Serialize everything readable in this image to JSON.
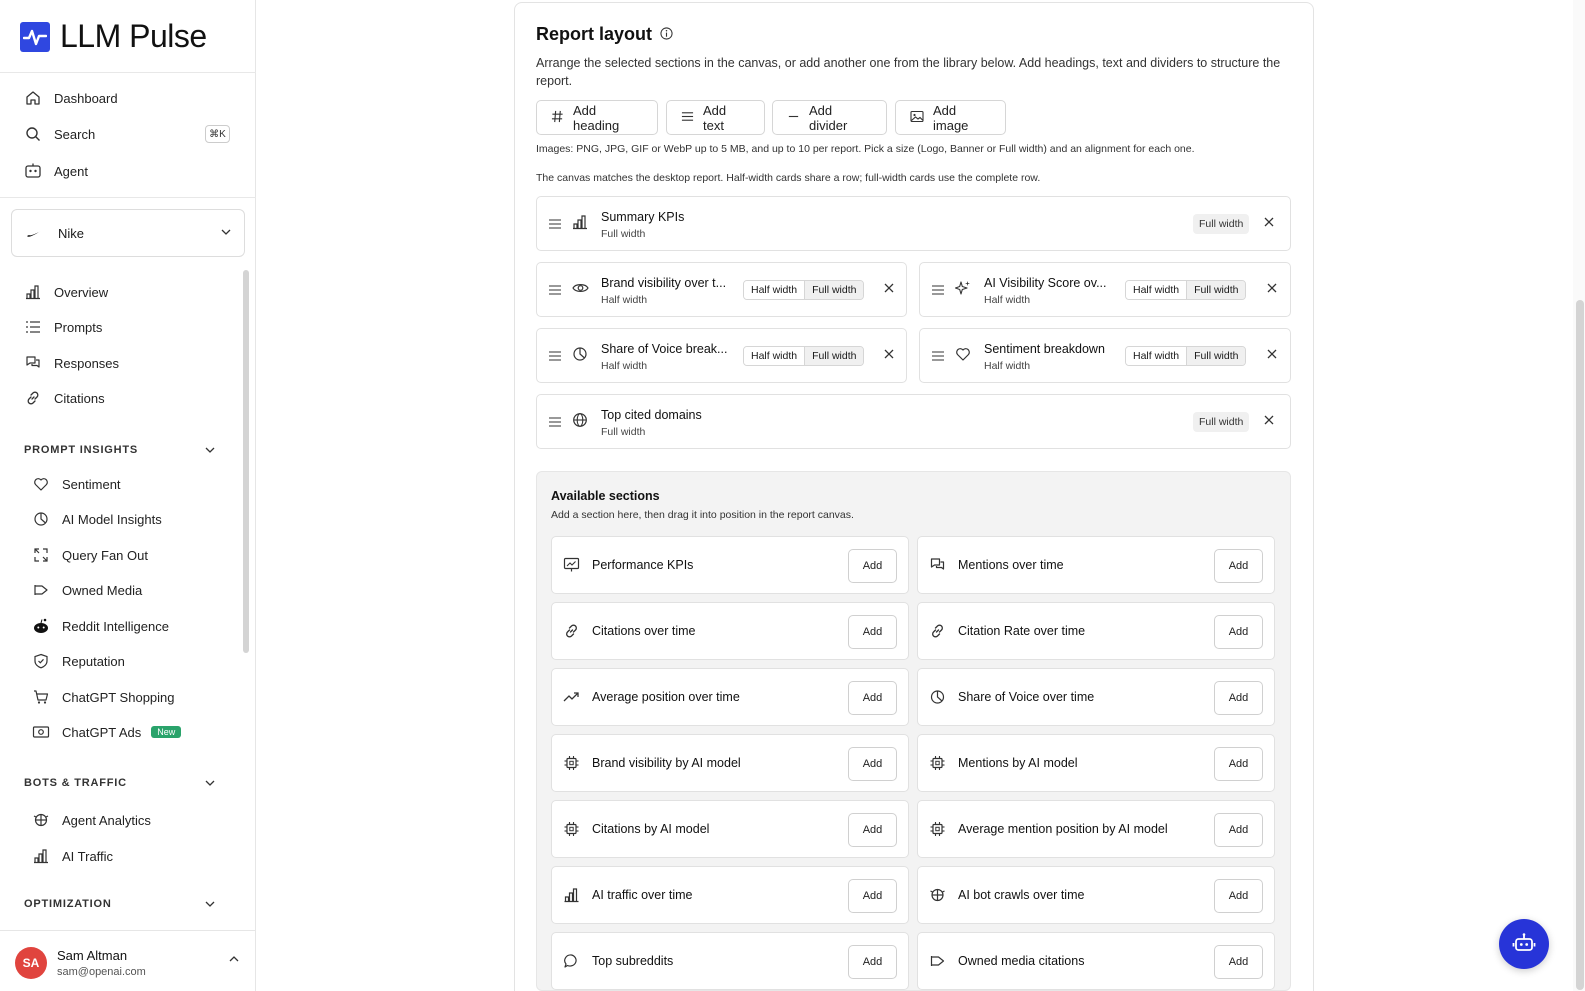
{
  "app": {
    "name": "LLM Pulse"
  },
  "nav": {
    "dashboard": "Dashboard",
    "search": "Search",
    "search_shortcut": "⌘K",
    "agent": "Agent"
  },
  "brand": {
    "name": "Nike"
  },
  "main_nav": [
    "Overview",
    "Prompts",
    "Responses",
    "Citations"
  ],
  "prompt_insights": {
    "heading": "PROMPT INSIGHTS",
    "items": [
      "Sentiment",
      "AI Model Insights",
      "Query Fan Out",
      "Owned Media",
      "Reddit Intelligence",
      "Reputation",
      "ChatGPT Shopping",
      "ChatGPT Ads"
    ],
    "new_badge": "New"
  },
  "bots_traffic": {
    "heading": "BOTS & TRAFFIC",
    "items": [
      "Agent Analytics",
      "AI Traffic"
    ]
  },
  "optimization": {
    "heading": "OPTIMIZATION"
  },
  "user": {
    "initials": "SA",
    "name": "Sam Altman",
    "email": "sam@openai.com"
  },
  "report": {
    "title": "Report layout",
    "description": "Arrange the selected sections in the canvas, or add another one from the library below. Add headings, text and dividers to structure the report.",
    "buttons": {
      "heading": "Add heading",
      "text": "Add text",
      "divider": "Add divider",
      "image": "Add image"
    },
    "images_note": "Images: PNG, JPG, GIF or WebP up to 5 MB, and up to 10 per report. Pick a size (Logo, Banner or Full width) and an alignment for each one.",
    "canvas_note": "The canvas matches the desktop report. Half-width cards share a row; full-width cards use the complete row.",
    "half_label": "Half width",
    "full_label": "Full width",
    "cards": [
      {
        "title": "Summary KPIs",
        "width": "Full width"
      },
      {
        "title": "Brand visibility over t...",
        "width": "Half width"
      },
      {
        "title": "AI Visibility Score ov...",
        "width": "Half width"
      },
      {
        "title": "Share of Voice break...",
        "width": "Half width"
      },
      {
        "title": "Sentiment breakdown",
        "width": "Half width"
      },
      {
        "title": "Top cited domains",
        "width": "Full width"
      }
    ]
  },
  "available": {
    "title": "Available sections",
    "subtitle": "Add a section here, then drag it into position in the report canvas.",
    "add_label": "Add",
    "items": [
      "Performance KPIs",
      "Mentions over time",
      "Citations over time",
      "Citation Rate over time",
      "Average position over time",
      "Share of Voice over time",
      "Brand visibility by AI model",
      "Mentions by AI model",
      "Citations by AI model",
      "Average mention position by AI model",
      "AI traffic over time",
      "AI bot crawls over time",
      "Top subreddits",
      "Owned media citations"
    ]
  }
}
